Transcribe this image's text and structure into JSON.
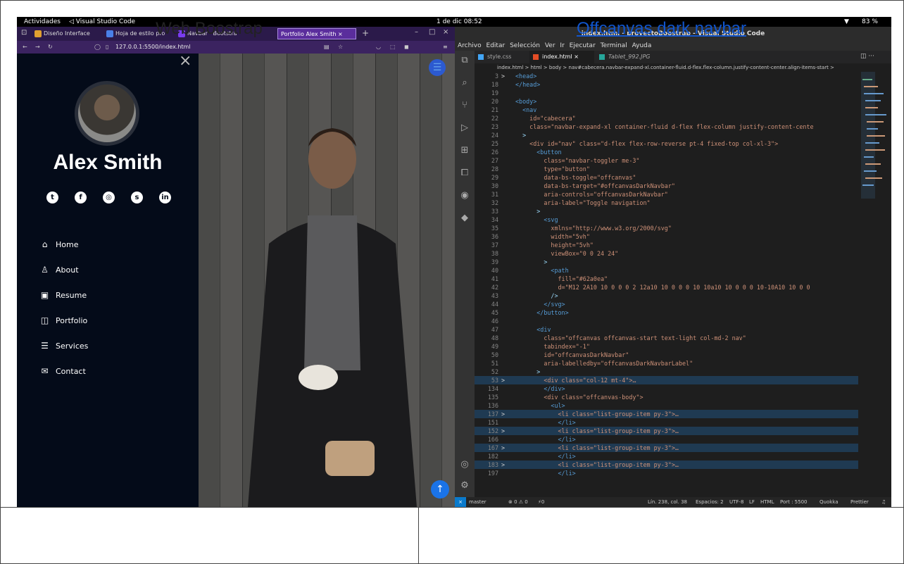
{
  "system_bar": {
    "activities": "Actividades",
    "app": "Visual Studio Code",
    "clock": "1 de dic 08:52",
    "battery": "83 %"
  },
  "browser": {
    "tabs": [
      {
        "label": "Diseño Interface",
        "icon_color": "#e0a030"
      },
      {
        "label": "Hoja de estilo pro",
        "icon_color": "#4a80e8"
      },
      {
        "label": "Navbar · Bootstra",
        "icon_color": "#7a3cf0"
      },
      {
        "label": "Portfolio Alex Smith",
        "icon_color": ""
      }
    ],
    "url": "127.0.0.1:5500/index.html"
  },
  "portfolio": {
    "name": "Alex Smith",
    "socials": [
      "twitter-icon",
      "facebook-icon",
      "instagram-icon",
      "skype-icon",
      "linkedin-icon"
    ],
    "nav": [
      {
        "label": "Home",
        "icon": "home-icon"
      },
      {
        "label": "About",
        "icon": "user-icon"
      },
      {
        "label": "Resume",
        "icon": "file-icon"
      },
      {
        "label": "Portfolio",
        "icon": "book-icon"
      },
      {
        "label": "Services",
        "icon": "server-icon"
      },
      {
        "label": "Contact",
        "icon": "envelope-icon"
      }
    ]
  },
  "vscode": {
    "title": "index.html - proyectoBoostrap - Visual Studio Code",
    "menu": [
      "Archivo",
      "Editar",
      "Selección",
      "Ver",
      "Ir",
      "Ejecutar",
      "Terminal",
      "Ayuda"
    ],
    "tabs": [
      {
        "label": "style.css",
        "active": false
      },
      {
        "label": "index.html",
        "active": true
      },
      {
        "label": "Tablet_992.JPG",
        "active": false
      }
    ],
    "breadcrumb": "index.html > html > body > nav#cabecera.navbar-expand-xl.container-fluid.d-flex.flex-column.justify-content-center.align-items-start >",
    "lines": [
      {
        "n": "3",
        "t": "<head>",
        "hl": false,
        "fold": ">"
      },
      {
        "n": "18",
        "t": "</head>",
        "hl": false,
        "fold": ""
      },
      {
        "n": "19",
        "t": "",
        "hl": false,
        "fold": ""
      },
      {
        "n": "20",
        "t": "<body>",
        "hl": false,
        "fold": ""
      },
      {
        "n": "21",
        "t": "  <nav",
        "hl": false,
        "fold": ""
      },
      {
        "n": "22",
        "t": "    id=\"cabecera\"",
        "hl": false,
        "fold": ""
      },
      {
        "n": "23",
        "t": "    class=\"navbar-expand-xl container-fluid d-flex flex-column justify-content-cente",
        "hl": false,
        "fold": ""
      },
      {
        "n": "24",
        "t": "  >",
        "hl": false,
        "fold": ""
      },
      {
        "n": "25",
        "t": "    <div id=\"nav\" class=\"d-flex flex-row-reverse pt-4 fixed-top col-xl-3\">",
        "hl": false,
        "fold": ""
      },
      {
        "n": "26",
        "t": "      <button",
        "hl": false,
        "fold": ""
      },
      {
        "n": "27",
        "t": "        class=\"navbar-toggler me-3\"",
        "hl": false,
        "fold": ""
      },
      {
        "n": "28",
        "t": "        type=\"button\"",
        "hl": false,
        "fold": ""
      },
      {
        "n": "29",
        "t": "        data-bs-toggle=\"offcanvas\"",
        "hl": false,
        "fold": ""
      },
      {
        "n": "30",
        "t": "        data-bs-target=\"#offcanvasDarkNavbar\"",
        "hl": false,
        "fold": ""
      },
      {
        "n": "31",
        "t": "        aria-controls=\"offcanvasDarkNavbar\"",
        "hl": false,
        "fold": ""
      },
      {
        "n": "32",
        "t": "        aria-label=\"Toggle navigation\"",
        "hl": false,
        "fold": ""
      },
      {
        "n": "33",
        "t": "      >",
        "hl": false,
        "fold": ""
      },
      {
        "n": "34",
        "t": "        <svg",
        "hl": false,
        "fold": ""
      },
      {
        "n": "35",
        "t": "          xmlns=\"http://www.w3.org/2000/svg\"",
        "hl": false,
        "fold": ""
      },
      {
        "n": "36",
        "t": "          width=\"5vh\"",
        "hl": false,
        "fold": ""
      },
      {
        "n": "37",
        "t": "          height=\"5vh\"",
        "hl": false,
        "fold": ""
      },
      {
        "n": "38",
        "t": "          viewBox=\"0 0 24 24\"",
        "hl": false,
        "fold": ""
      },
      {
        "n": "39",
        "t": "        >",
        "hl": false,
        "fold": ""
      },
      {
        "n": "40",
        "t": "          <path",
        "hl": false,
        "fold": ""
      },
      {
        "n": "41",
        "t": "            fill=\"#62a0ea\"",
        "hl": false,
        "fold": ""
      },
      {
        "n": "42",
        "t": "            d=\"M12 2A10 10 0 0 0 2 12a10 10 0 0 0 10 10a10 10 0 0 0 10-10A10 10 0 0",
        "hl": false,
        "fold": ""
      },
      {
        "n": "43",
        "t": "          />",
        "hl": false,
        "fold": ""
      },
      {
        "n": "44",
        "t": "        </svg>",
        "hl": false,
        "fold": ""
      },
      {
        "n": "45",
        "t": "      </button>",
        "hl": false,
        "fold": ""
      },
      {
        "n": "46",
        "t": "",
        "hl": false,
        "fold": ""
      },
      {
        "n": "47",
        "t": "      <div",
        "hl": false,
        "fold": ""
      },
      {
        "n": "48",
        "t": "        class=\"offcanvas offcanvas-start text-light col-md-2 nav\"",
        "hl": false,
        "fold": ""
      },
      {
        "n": "49",
        "t": "        tabindex=\"-1\"",
        "hl": false,
        "fold": ""
      },
      {
        "n": "50",
        "t": "        id=\"offcanvasDarkNavbar\"",
        "hl": false,
        "fold": ""
      },
      {
        "n": "51",
        "t": "        aria-labelledby=\"offcanvasDarkNavbarLabel\"",
        "hl": false,
        "fold": ""
      },
      {
        "n": "52",
        "t": "      >",
        "hl": false,
        "fold": ""
      },
      {
        "n": "53",
        "t": "        <div class=\"col-12 mt-4\">…",
        "hl": true,
        "fold": ">"
      },
      {
        "n": "134",
        "t": "        </div>",
        "hl": false,
        "fold": ""
      },
      {
        "n": "135",
        "t": "        <div class=\"offcanvas-body\">",
        "hl": false,
        "fold": ""
      },
      {
        "n": "136",
        "t": "          <ul>",
        "hl": false,
        "fold": ""
      },
      {
        "n": "137",
        "t": "            <li class=\"list-group-item py-3\">…",
        "hl": true,
        "fold": ">"
      },
      {
        "n": "151",
        "t": "            </li>",
        "hl": false,
        "fold": ""
      },
      {
        "n": "152",
        "t": "            <li class=\"list-group-item py-3\">…",
        "hl": true,
        "fold": ">"
      },
      {
        "n": "166",
        "t": "            </li>",
        "hl": false,
        "fold": ""
      },
      {
        "n": "167",
        "t": "            <li class=\"list-group-item py-3\">…",
        "hl": true,
        "fold": ">"
      },
      {
        "n": "182",
        "t": "            </li>",
        "hl": false,
        "fold": ""
      },
      {
        "n": "183",
        "t": "            <li class=\"list-group-item py-3\">…",
        "hl": true,
        "fold": ">"
      },
      {
        "n": "197",
        "t": "            </li>",
        "hl": false,
        "fold": ""
      }
    ],
    "status": {
      "branch": "master",
      "problems": "⊗ 0 ⚠ 0",
      "ports": "⚡0",
      "position": "Lín. 238, col. 38",
      "spaces": "Espacios: 2",
      "encoding": "UTF-8",
      "eol": "LF",
      "language": "HTML",
      "port": "Port : 5500",
      "quokka": "Quokka",
      "prettier": "Prettier"
    }
  },
  "captions": {
    "left": "Web Boostrap",
    "right": "Offcanvas dark navbar",
    "right_color": "#1155cc"
  }
}
